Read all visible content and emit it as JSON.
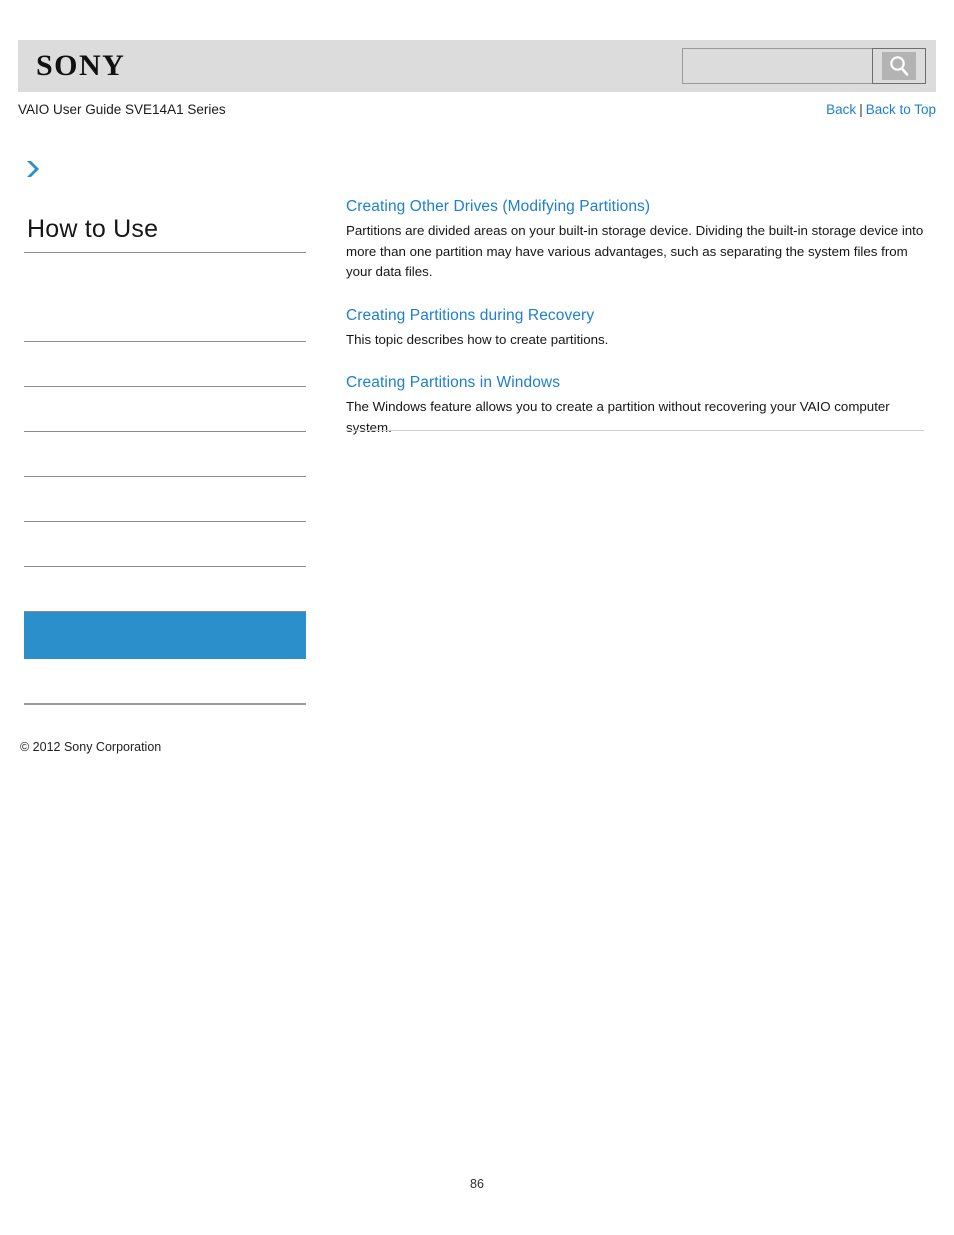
{
  "header": {
    "logo_text": "SONY",
    "search": {
      "value": "",
      "placeholder": "",
      "icon": "search-icon",
      "button_label": ""
    }
  },
  "subheader": {
    "guide_title": "VAIO User Guide SVE14A1 Series",
    "links": [
      {
        "label": "Back"
      },
      {
        "label": "Back to Top"
      }
    ],
    "separator": "|"
  },
  "sidebar": {
    "arrow_icon": "chevron-right-icon",
    "heading": "How to Use",
    "items": [
      {
        "label": "",
        "selected": false
      },
      {
        "label": "",
        "selected": false
      },
      {
        "label": "",
        "selected": false
      },
      {
        "label": "",
        "selected": false
      },
      {
        "label": "",
        "selected": false
      },
      {
        "label": "",
        "selected": false
      },
      {
        "label": "",
        "selected": false
      },
      {
        "label": "",
        "selected": true
      },
      {
        "label": "",
        "selected": false
      }
    ],
    "selected_color": "#2b8fcc"
  },
  "content": {
    "topics": [
      {
        "title": "Creating Other Drives (Modifying Partitions)",
        "description": "Partitions are divided areas on your built-in storage device. Dividing the built-in storage device into more than one partition may have various advantages, such as separating the system files from your data files."
      },
      {
        "title": "Creating Partitions during Recovery",
        "description": "This topic describes how to create partitions."
      },
      {
        "title": "Creating Partitions in Windows",
        "description": "The Windows feature allows you to create a partition without recovering your VAIO computer system."
      }
    ]
  },
  "footer": {
    "copyright": "© 2012 Sony Corporation",
    "page_number": "86"
  },
  "colors": {
    "link": "#1c7fd0",
    "accent": "#2b8fcc",
    "header_band": "#dcdcdc",
    "rule": "#8d8d8d"
  }
}
